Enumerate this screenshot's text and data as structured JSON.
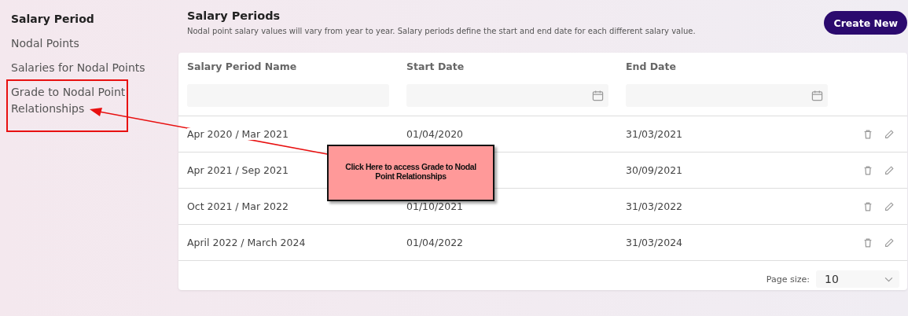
{
  "sidebar": {
    "items": [
      {
        "label": "Salary Period",
        "selected": true
      },
      {
        "label": "Nodal Points",
        "selected": false
      },
      {
        "label": "Salaries for Nodal Points",
        "selected": false
      },
      {
        "label": "Grade to Nodal Point Relationships",
        "selected": false,
        "highlighted": true
      }
    ]
  },
  "header": {
    "title": "Salary Periods",
    "description": "Nodal point salary values will vary from year to year. Salary periods define the start and end date for each different salary value.",
    "create_button": "Create New"
  },
  "table": {
    "columns": [
      {
        "label": "Salary Period Name",
        "kind": "text"
      },
      {
        "label": "Start Date",
        "kind": "date"
      },
      {
        "label": "End Date",
        "kind": "date"
      }
    ],
    "rows": [
      {
        "name": "Apr 2020 / Mar 2021",
        "start": "01/04/2020",
        "end": "31/03/2021"
      },
      {
        "name": "Apr 2021 / Sep 2021",
        "end": "30/09/2021"
      },
      {
        "name": "Oct 2021 / Mar 2022",
        "start": "01/10/2021",
        "end": "31/03/2022"
      },
      {
        "name": "April 2022 / March 2024",
        "start": "01/04/2022",
        "end": "31/03/2024"
      }
    ],
    "page_size_label": "Page size:",
    "page_size": "10"
  },
  "annotation": {
    "callout": "Click Here to access Grade to Nodal Point Relationships"
  }
}
